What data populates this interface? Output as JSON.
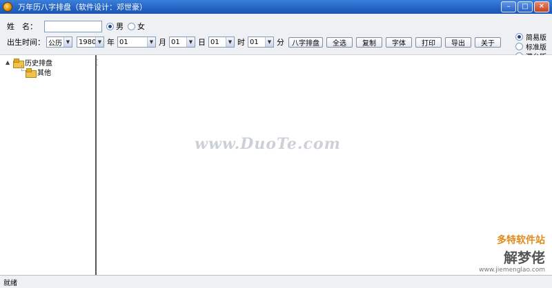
{
  "window": {
    "title": "万年历八字排盘（软件设计：邓世豪）",
    "minimize": "–",
    "maximize": "□",
    "close": "✕"
  },
  "form": {
    "name_label": "姓　名：",
    "name_value": "",
    "gender": {
      "male": "男",
      "female": "女",
      "selected": "male"
    },
    "birth_label": "出生时间：",
    "calendar": "公历",
    "year": "1980",
    "year_unit": "年",
    "month": "01",
    "month_unit": "月",
    "day": "01",
    "day_unit": "日",
    "hour": "01",
    "hour_unit": "时",
    "minute": "01",
    "minute_unit": "分"
  },
  "buttons": {
    "bazi": "八字排盘",
    "select_all": "全选",
    "copy": "复制",
    "font": "字体",
    "print": "打印",
    "export": "导出",
    "about": "关于"
  },
  "editions": {
    "simple": "简易版",
    "standard": "标准版",
    "hk": "港台版",
    "selected": "simple"
  },
  "tree": {
    "root": "历史排盘",
    "child": "其他"
  },
  "watermark": "www.DuoTe.com",
  "brand": {
    "line1": "多特软件站",
    "line2": "解梦佬",
    "line3": "www.jiemenglao.com"
  },
  "status": "就绪"
}
